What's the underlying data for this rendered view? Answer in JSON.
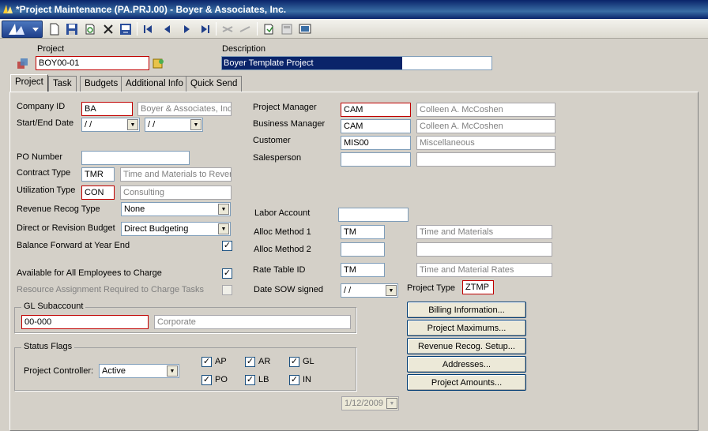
{
  "window": {
    "title": "*Project Maintenance (PA.PRJ.00) - Boyer & Associates, Inc."
  },
  "header": {
    "project_label": "Project",
    "project_value": "BOY00-01",
    "description_label": "Description",
    "description_value": "Boyer Template Project"
  },
  "tabs": [
    "Project",
    "Task",
    "Budgets",
    "Additional Info",
    "Quick Send"
  ],
  "left": {
    "company_id_label": "Company ID",
    "company_id": "BA",
    "company_name": "Boyer & Associates, Inc",
    "start_end_label": "Start/End Date",
    "start_date": " / /",
    "end_date": " / /",
    "po_number_label": "PO Number",
    "po_number": "",
    "contract_type_label": "Contract Type",
    "contract_type": "TMR",
    "contract_type_desc": "Time and Materials to Reven",
    "utilization_type_label": "Utilization Type",
    "utilization_type": "CON",
    "utilization_type_desc": "Consulting",
    "revenue_recog_label": "Revenue Recog Type",
    "revenue_recog": "None",
    "direct_rev_label": "Direct or Revision Budget",
    "direct_rev": "Direct Budgeting",
    "balance_fwd_label": "Balance  Forward at Year End",
    "available_label": "Available for All Employees to Charge",
    "resource_assign_label": "Resource Assignment Required to Charge Tasks"
  },
  "right": {
    "project_manager_label": "Project Manager",
    "project_manager": "CAM",
    "project_manager_name": "Colleen A. McCoshen",
    "business_manager_label": "Business Manager",
    "business_manager": "CAM",
    "business_manager_name": "Colleen A. McCoshen",
    "customer_label": "Customer",
    "customer": "MIS00",
    "customer_name": "Miscellaneous",
    "salesperson_label": "Salesperson",
    "salesperson": "",
    "salesperson_name": "",
    "labor_account_label": "Labor Account",
    "labor_account": "",
    "alloc1_label": "Alloc Method 1",
    "alloc1": "TM",
    "alloc1_desc": "Time and Materials",
    "alloc2_label": "Alloc Method 2",
    "alloc2": "",
    "alloc2_desc": "",
    "rate_table_label": "Rate Table ID",
    "rate_table": "TM",
    "rate_table_desc": "Time and Material Rates",
    "date_sow_label": "Date SOW signed",
    "date_sow": " / /",
    "project_type_label": "Project Type",
    "project_type": "ZTMP"
  },
  "gl": {
    "group_label": "GL Subaccount",
    "subaccount": "00-000",
    "subaccount_desc": "Corporate"
  },
  "status": {
    "group_label": "Status Flags",
    "controller_label": "Project Controller:",
    "controller": "Active",
    "flags": [
      {
        "label": "AP",
        "checked": true
      },
      {
        "label": "AR",
        "checked": true
      },
      {
        "label": "GL",
        "checked": true
      },
      {
        "label": "PO",
        "checked": true
      },
      {
        "label": "LB",
        "checked": true
      },
      {
        "label": "IN",
        "checked": true
      }
    ]
  },
  "buttons": {
    "billing": "Billing Information...",
    "maximums": "Project Maximums...",
    "revenue_setup": "Revenue Recog. Setup...",
    "addresses": "Addresses...",
    "amounts": "Project Amounts..."
  },
  "footer": {
    "date": "1/12/2009"
  },
  "checks": {
    "balance_forward": true,
    "available_all": true,
    "resource_required": false
  },
  "colors": {
    "required_border": "#c00000",
    "titlebar": "#0a246a"
  }
}
